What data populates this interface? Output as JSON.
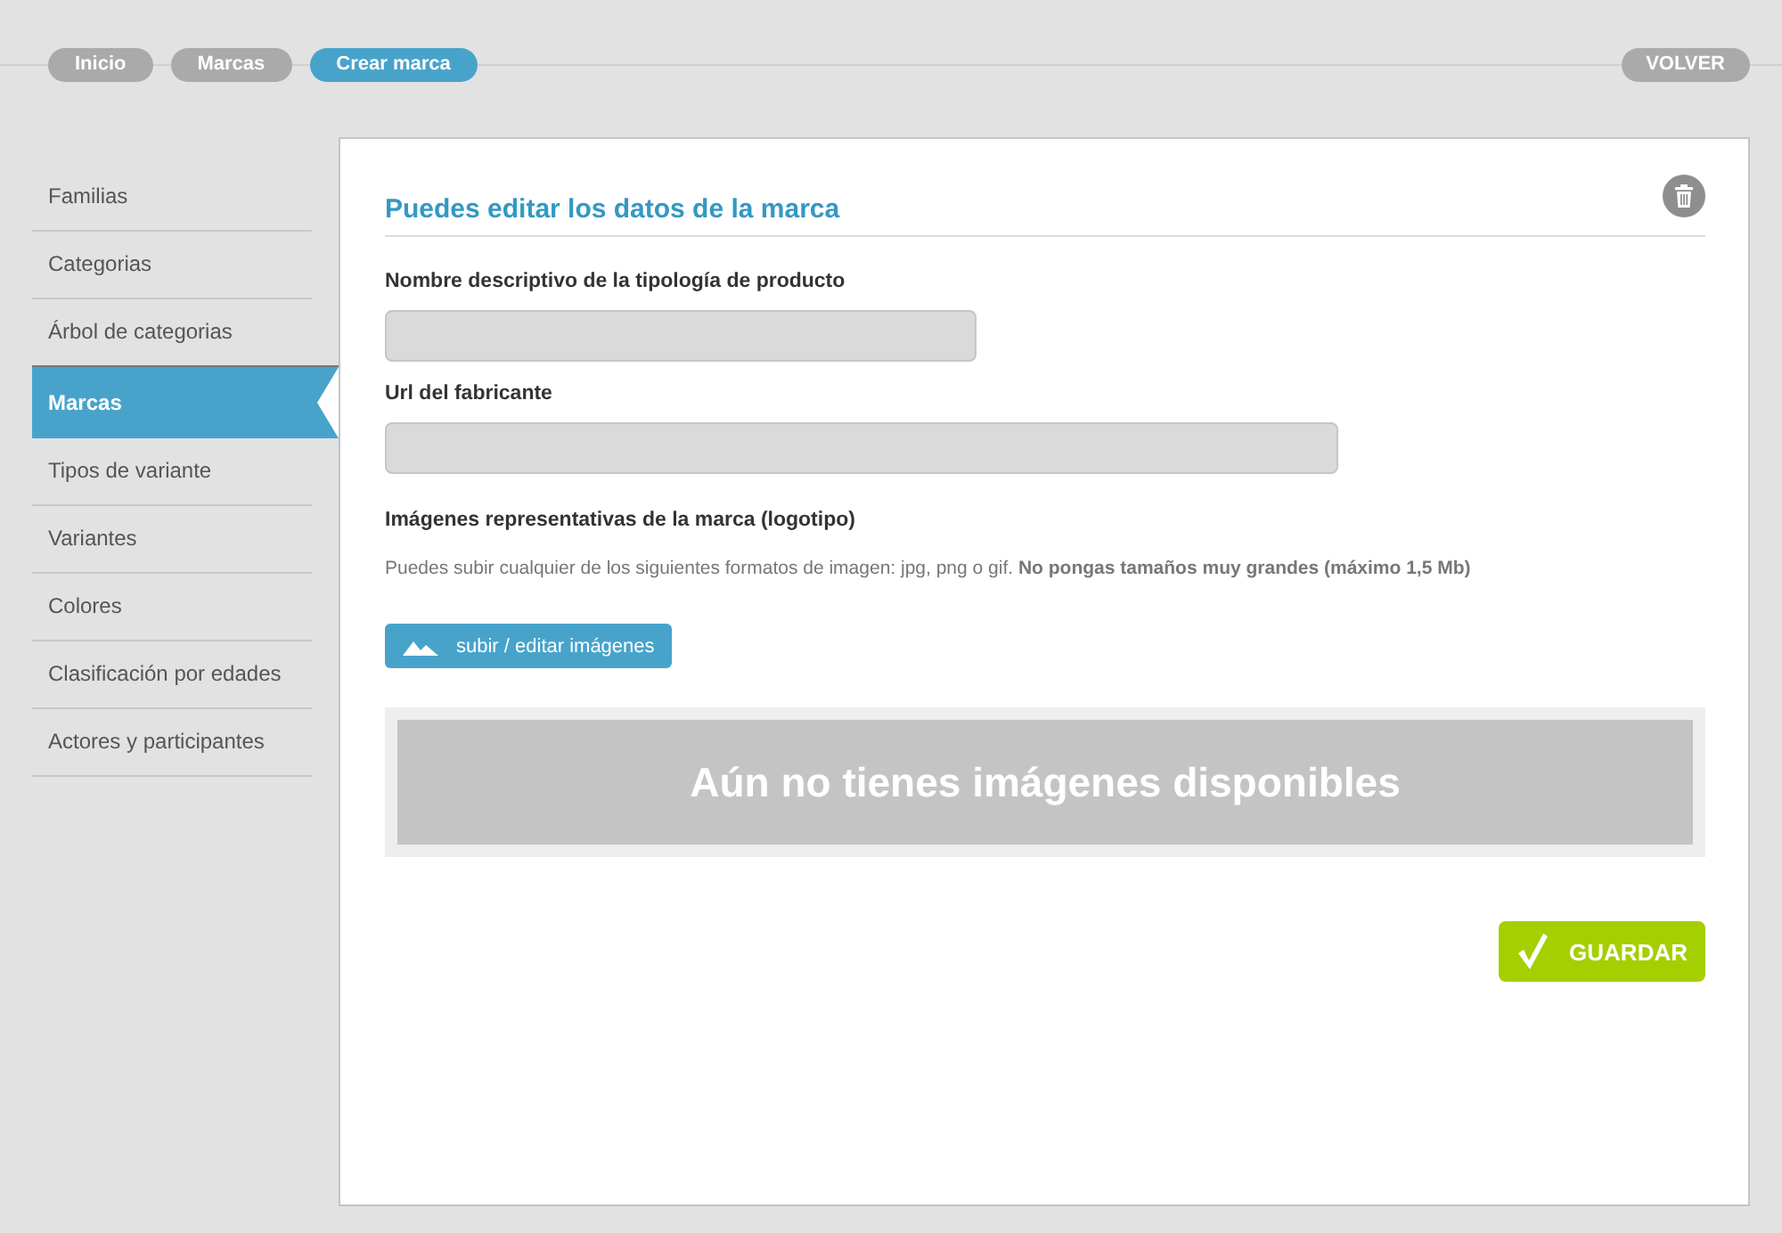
{
  "breadcrumbs": [
    {
      "label": "Inicio",
      "selected": false
    },
    {
      "label": "Marcas",
      "selected": false
    },
    {
      "label": "Crear marca",
      "selected": true
    }
  ],
  "back_button": "VOLVER",
  "sidebar": {
    "items": [
      {
        "label": "Familias",
        "selected": false
      },
      {
        "label": "Categorias",
        "selected": false
      },
      {
        "label": "Árbol de categorias",
        "selected": false
      },
      {
        "label": "Marcas",
        "selected": true
      },
      {
        "label": "Tipos de variante",
        "selected": false
      },
      {
        "label": "Variantes",
        "selected": false
      },
      {
        "label": "Colores",
        "selected": false
      },
      {
        "label": "Clasificación por edades",
        "selected": false
      },
      {
        "label": "Actores y participantes",
        "selected": false
      }
    ]
  },
  "form": {
    "title": "Puedes editar los datos de la marca",
    "fields": [
      {
        "label": "Nombre descriptivo de la tipología de producto"
      },
      {
        "label": "Url del fabricante"
      }
    ],
    "images": {
      "label": "Imágenes representativas de la marca (logotipo)",
      "help": "Puedes subir cualquier de los siguientes formatos de imagen: jpg, png o gif. **No pongas tamaños muy grandes (máximo 1,5 Mb)**",
      "upload_button": "subir / editar imágenes",
      "empty_message": "Aún no tienes imágenes disponibles"
    },
    "save_button": "GUARDAR"
  }
}
